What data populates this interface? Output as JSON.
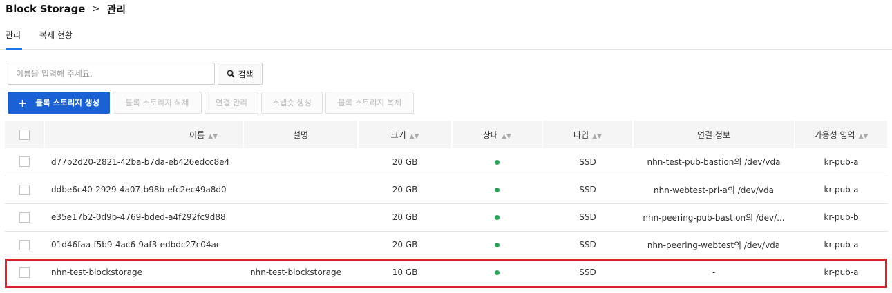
{
  "breadcrumb": {
    "root": "Block Storage",
    "separator": ">",
    "current": "관리"
  },
  "tabs": [
    {
      "label": "관리",
      "active": true
    },
    {
      "label": "복제 현황",
      "active": false
    }
  ],
  "search": {
    "placeholder": "이름을 입력해 주세요.",
    "value": "",
    "button_label": "검색"
  },
  "toolbar": {
    "create_label": "블록 스토리지 생성",
    "delete_label": "블록 스토리지 삭제",
    "connect_label": "연결 관리",
    "snapshot_label": "스냅숏 생성",
    "copy_label": "블록 스토리지 복제"
  },
  "table": {
    "headers": {
      "name": "이름",
      "desc": "설명",
      "size": "크기",
      "status": "상태",
      "type": "타입",
      "connection": "연결 정보",
      "zone": "가용성 영역"
    },
    "rows": [
      {
        "name": "d77b2d20-2821-42ba-b7da-eb426edcc8e4",
        "desc": "",
        "size": "20 GB",
        "status": "active",
        "type": "SSD",
        "connection": "nhn-test-pub-bastion의 /dev/vda",
        "zone": "kr-pub-a"
      },
      {
        "name": "ddbe6c40-2929-4a07-b98b-efc2ec49a8d0",
        "desc": "",
        "size": "20 GB",
        "status": "active",
        "type": "SSD",
        "connection": "nhn-webtest-pri-a의 /dev/vda",
        "zone": "kr-pub-a"
      },
      {
        "name": "e35e17b2-0d9b-4769-bded-a4f292fc9d88",
        "desc": "",
        "size": "20 GB",
        "status": "active",
        "type": "SSD",
        "connection": "nhn-peering-pub-bastion의 /dev/...",
        "zone": "kr-pub-b"
      },
      {
        "name": "01d46faa-f5b9-4ac6-9af3-edbdc27c04ac",
        "desc": "",
        "size": "20 GB",
        "status": "active",
        "type": "SSD",
        "connection": "nhn-peering-webtest의 /dev/vda",
        "zone": "kr-pub-a"
      },
      {
        "name": "nhn-test-blockstorage",
        "desc": "nhn-test-blockstorage",
        "size": "10 GB",
        "status": "active",
        "type": "SSD",
        "connection": "-",
        "zone": "kr-pub-a"
      }
    ]
  },
  "colors": {
    "primary": "#1a61d6",
    "tab_active": "#1a73e8",
    "status_active": "#27a35a",
    "highlight": "#d9232d"
  }
}
